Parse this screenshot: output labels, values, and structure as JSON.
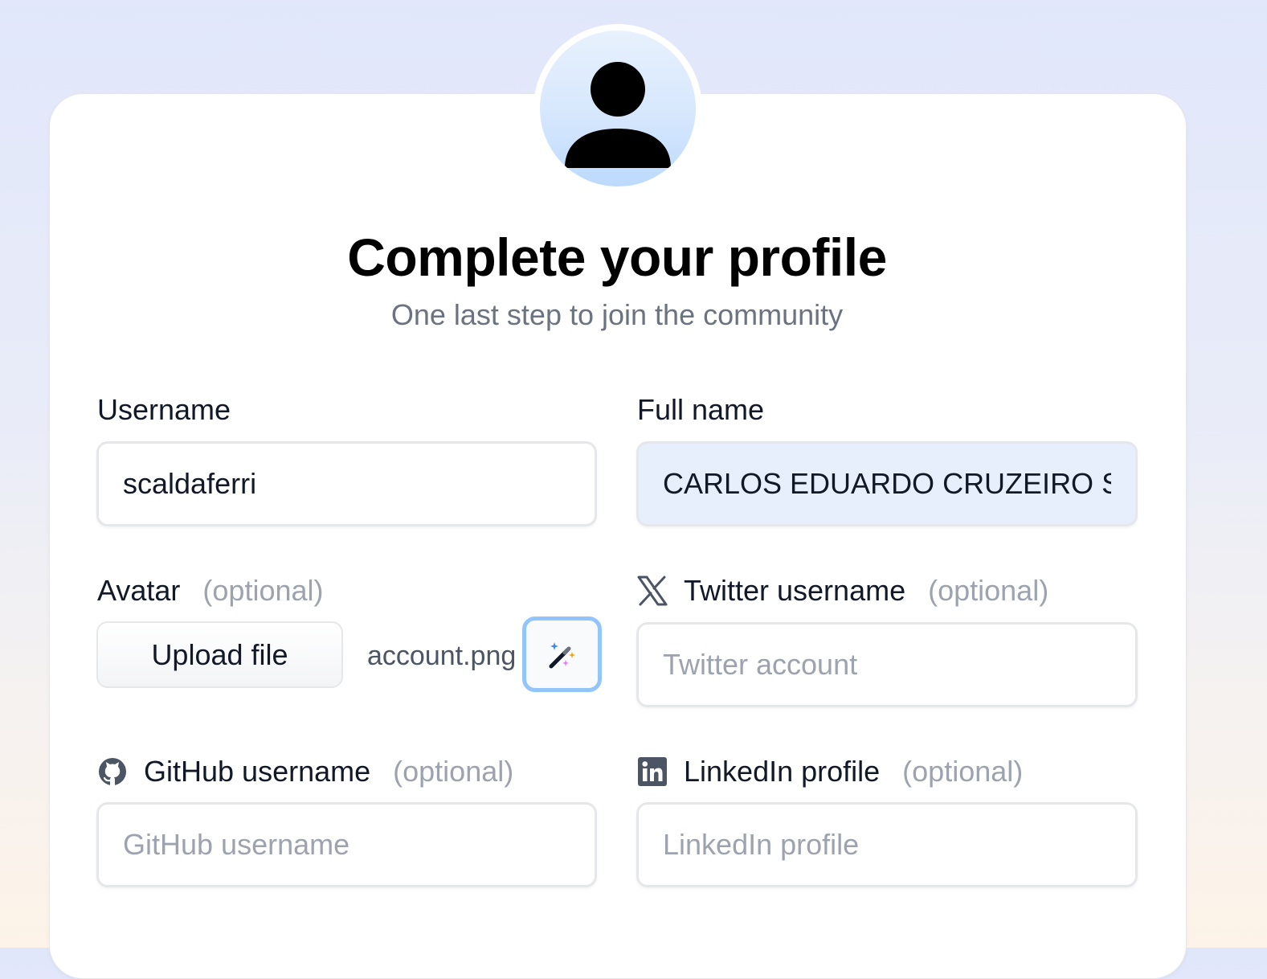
{
  "header": {
    "title": "Complete your profile",
    "subtitle": "One last step to join the community"
  },
  "avatar_icon": "user-silhouette-icon",
  "form": {
    "username": {
      "label": "Username",
      "value": "scaldaferri"
    },
    "full_name": {
      "label": "Full name",
      "value": "CARLOS EDUARDO CRUZEIRO SCA"
    },
    "avatar": {
      "label": "Avatar",
      "optional": "(optional)",
      "upload_label": "Upload file",
      "filename": "account.png",
      "generate_icon": "magic-wand-icon"
    },
    "twitter": {
      "label": "Twitter username",
      "optional": "(optional)",
      "placeholder": "Twitter account",
      "icon": "x-logo-icon"
    },
    "github": {
      "label": "GitHub username",
      "optional": "(optional)",
      "placeholder": "GitHub username",
      "icon": "github-icon"
    },
    "linkedin": {
      "label": "LinkedIn profile",
      "optional": "(optional)",
      "placeholder": "LinkedIn profile",
      "icon": "linkedin-icon"
    }
  },
  "colors": {
    "accent_ring": "#93c5fd",
    "filled_field_bg": "#e8effc",
    "optional_text": "#9ca3af"
  }
}
